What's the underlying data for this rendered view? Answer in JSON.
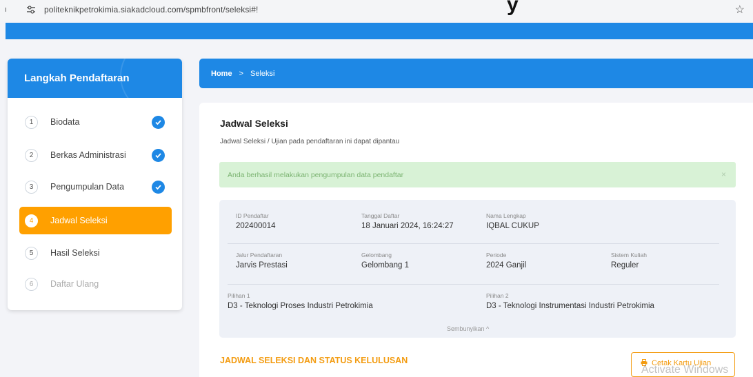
{
  "browser": {
    "left_mark": "ı",
    "url": "politeknikpetrokimia.siakadcloud.com/spmbfront/seleksi#!",
    "clipped_text": "y"
  },
  "sidebar": {
    "title": "Langkah Pendaftaran",
    "steps": [
      {
        "num": "1",
        "label": "Biodata",
        "done": true
      },
      {
        "num": "2",
        "label": "Berkas Administrasi",
        "done": true
      },
      {
        "num": "3",
        "label": "Pengumpulan Data",
        "done": true
      },
      {
        "num": "4",
        "label": "Jadwal Seleksi",
        "active": true
      },
      {
        "num": "5",
        "label": "Hasil Seleksi"
      },
      {
        "num": "6",
        "label": "Daftar Ulang",
        "disabled": true
      }
    ]
  },
  "breadcrumb": {
    "home": "Home",
    "separator": ">",
    "current": "Seleksi"
  },
  "main": {
    "title": "Jadwal Seleksi",
    "subtitle": "Jadwal Seleksi / Ujian pada pendaftaran ini dapat dipantau",
    "alert": "Anda berhasil melakukan pengumpulan data pendaftar",
    "alert_close": "×",
    "info": {
      "id_label": "ID Pendaftar",
      "id_value": "202400014",
      "tgl_label": "Tanggal Daftar",
      "tgl_value": "18 Januari 2024, 16:24:27",
      "nama_label": "Nama Lengkap",
      "nama_value": "IQBAL CUKUP",
      "jalur_label": "Jalur Pendaftaran",
      "jalur_value": "Jarvis Prestasi",
      "gel_label": "Gelombang",
      "gel_value": "Gelombang 1",
      "periode_label": "Periode",
      "periode_value": "2024 Ganjil",
      "sistem_label": "Sistem Kuliah",
      "sistem_value": "Reguler",
      "pil1_label": "Pilihan 1",
      "pil1_value": "D3 - Teknologi Proses Industri Petrokimia",
      "pil2_label": "Pilihan 2",
      "pil2_value": "D3 - Teknologi Instrumentasi Industri Petrokimia",
      "hide_link": "Sembunyikan ^"
    },
    "section_title": "JADWAL SELEKSI DAN STATUS KELULUSAN",
    "print_button": "Cetak Kartu Ujian"
  },
  "watermark": "Activate Windows",
  "colors": {
    "primary": "#1e88e5",
    "active": "#ffa000",
    "accent": "#f39c12",
    "success_bg": "#d8f2d6"
  }
}
